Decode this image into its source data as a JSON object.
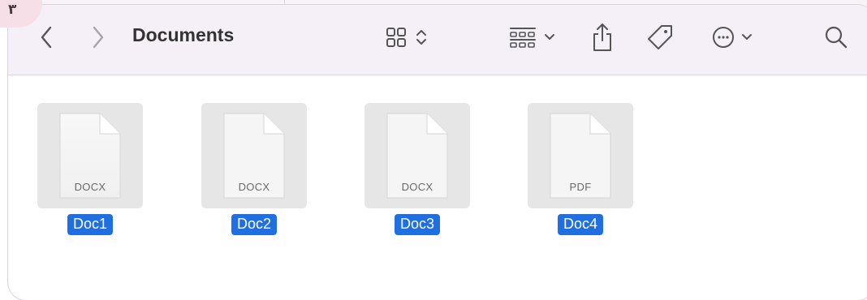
{
  "corner_badge": {
    "text": "۳"
  },
  "toolbar": {
    "title": "Documents",
    "icons": [
      "back-chevron-icon",
      "forward-chevron-icon",
      "grid-view-icon",
      "sort-chevrons-icon",
      "group-view-icon",
      "chevron-down-icon",
      "share-icon",
      "tag-icon",
      "more-options-icon",
      "chevron-down-icon",
      "search-icon"
    ]
  },
  "files": [
    {
      "name": "Doc1",
      "ext": "DOCX"
    },
    {
      "name": "Doc2",
      "ext": "DOCX"
    },
    {
      "name": "Doc3",
      "ext": "DOCX"
    },
    {
      "name": "Doc4",
      "ext": "PDF"
    }
  ],
  "colors": {
    "toolbar_bg": "#f5eff8",
    "selection_blue": "#1f6fe0",
    "thumb_bg": "#e6e6e6",
    "icon_gray": "#555555"
  }
}
